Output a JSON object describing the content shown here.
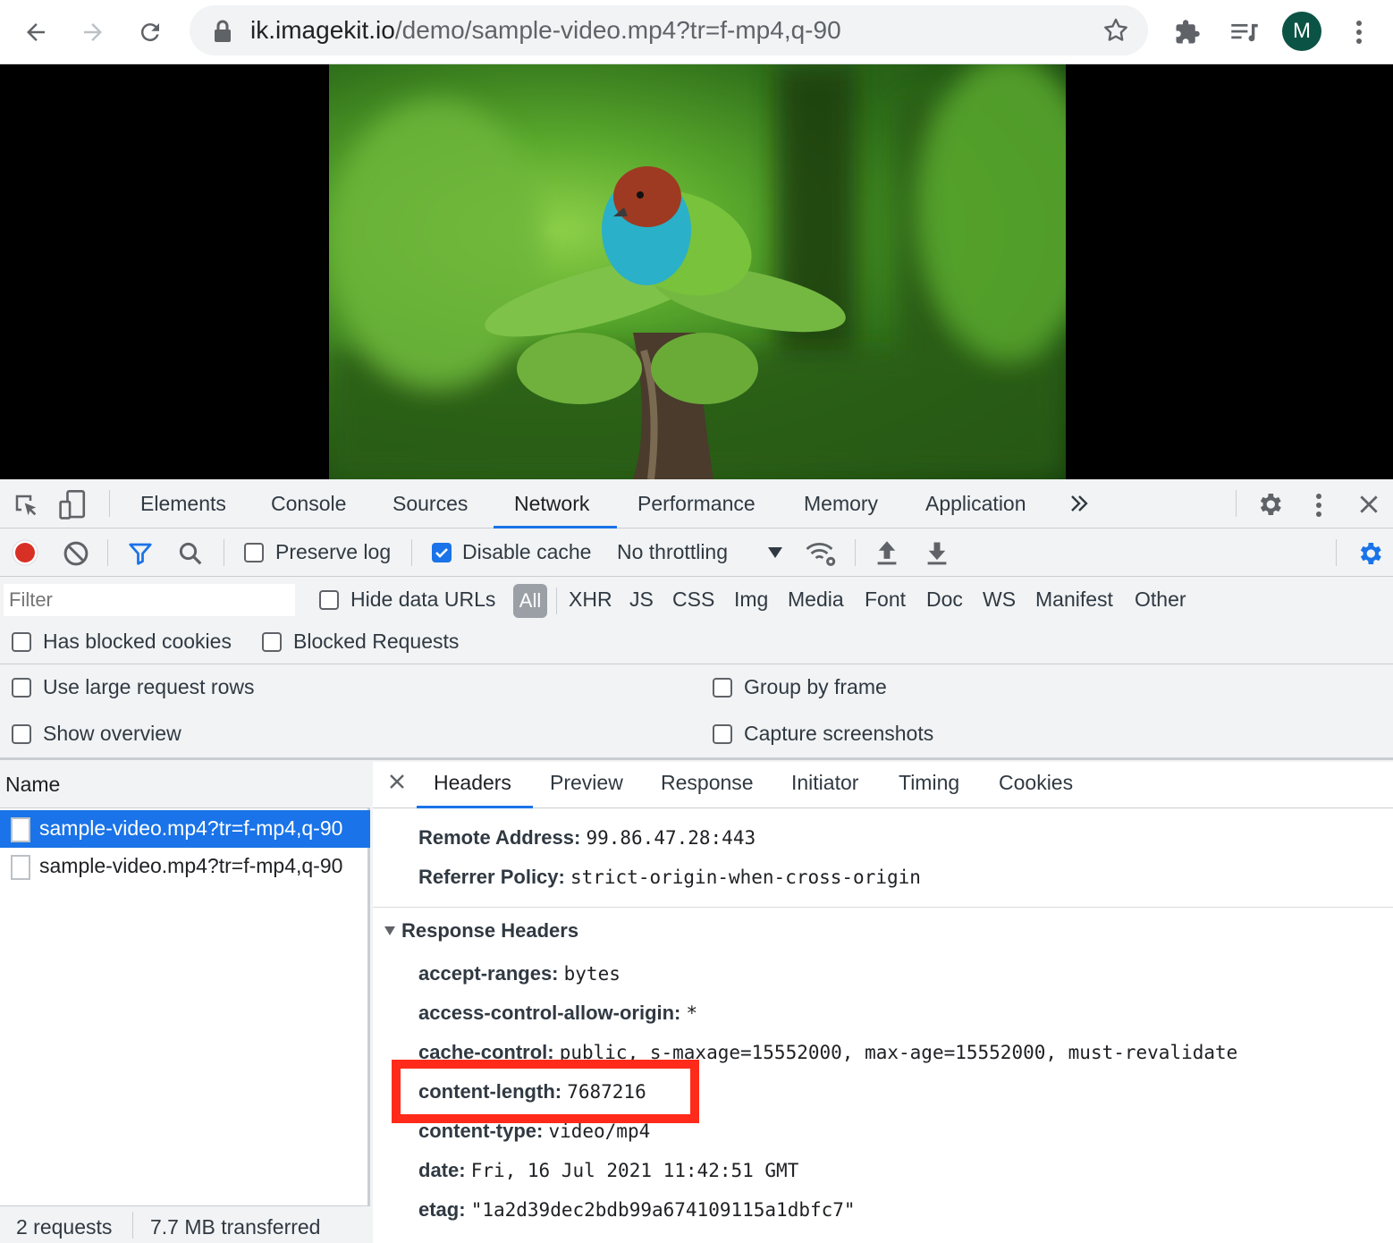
{
  "browser": {
    "url_host": "ik.imagekit.io",
    "url_path": "/demo/sample-video.mp4?tr=f-mp4,q-90",
    "avatar_letter": "M"
  },
  "devtools": {
    "tabs": [
      "Elements",
      "Console",
      "Sources",
      "Network",
      "Performance",
      "Memory",
      "Application"
    ],
    "active_tab": "Network",
    "toolbar": {
      "preserve_log": "Preserve log",
      "disable_cache": "Disable cache",
      "throttling": "No throttling"
    },
    "filter": {
      "placeholder": "Filter",
      "hide_data_urls": "Hide data URLs",
      "types": [
        "All",
        "XHR",
        "JS",
        "CSS",
        "Img",
        "Media",
        "Font",
        "Doc",
        "WS",
        "Manifest",
        "Other"
      ],
      "has_blocked_cookies": "Has blocked cookies",
      "blocked_requests": "Blocked Requests"
    },
    "settings": {
      "use_large_rows": "Use large request rows",
      "show_overview": "Show overview",
      "group_by_frame": "Group by frame",
      "capture_screenshots": "Capture screenshots"
    },
    "requests": {
      "header": "Name",
      "items": [
        "sample-video.mp4?tr=f-mp4,q-90",
        "sample-video.mp4?tr=f-mp4,q-90"
      ],
      "status_count": "2 requests",
      "status_transferred": "7.7 MB transferred"
    },
    "details": {
      "tabs": [
        "Headers",
        "Preview",
        "Response",
        "Initiator",
        "Timing",
        "Cookies"
      ],
      "general": [
        {
          "k": "Remote Address:",
          "v": "99.86.47.28:443"
        },
        {
          "k": "Referrer Policy:",
          "v": "strict-origin-when-cross-origin"
        }
      ],
      "response_headers_title": "Response Headers",
      "response_headers": [
        {
          "k": "accept-ranges:",
          "v": "bytes"
        },
        {
          "k": "access-control-allow-origin:",
          "v": "*"
        },
        {
          "k": "cache-control:",
          "v": "public, s-maxage=15552000, max-age=15552000, must-revalidate"
        },
        {
          "k": "content-length:",
          "v": "7687216"
        },
        {
          "k": "content-type:",
          "v": "video/mp4"
        },
        {
          "k": "date:",
          "v": "Fri, 16 Jul 2021 11:42:51 GMT"
        },
        {
          "k": "etag:",
          "v": "\"1a2d39dec2bdb99a674109115a1dbfc7\""
        }
      ]
    }
  },
  "colors": {
    "accent": "#1a73e8",
    "highlight": "#ff2a1a",
    "record": "#d93025"
  }
}
